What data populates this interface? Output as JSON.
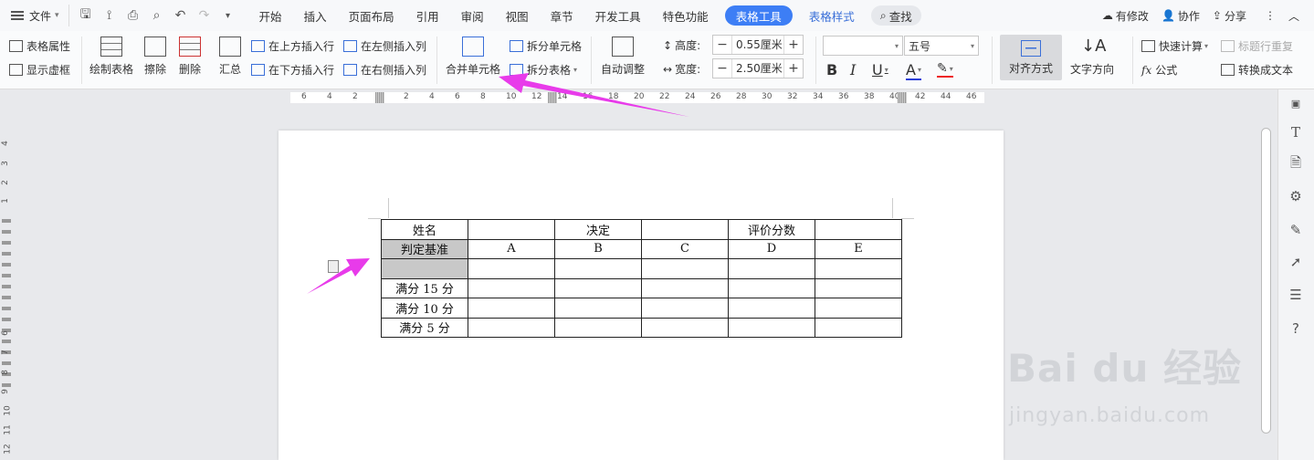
{
  "menubar": {
    "file_label": "文件",
    "tabs": [
      "开始",
      "插入",
      "页面布局",
      "引用",
      "审阅",
      "视图",
      "章节",
      "开发工具",
      "特色功能"
    ],
    "tool_tab": "表格工具",
    "tool_tab2": "表格样式",
    "search": "查找",
    "right": {
      "changes": "有修改",
      "collab": "协作",
      "share": "分享"
    }
  },
  "ribbon": {
    "table_props": "表格属性",
    "show_grid": "显示虚框",
    "draw_table": "绘制表格",
    "erase": "擦除",
    "delete": "删除",
    "summary": "汇总",
    "insert_above": "在上方插入行",
    "insert_below": "在下方插入行",
    "insert_left": "在左侧插入列",
    "insert_right": "在右侧插入列",
    "merge_cells": "合并单元格",
    "split_cells": "拆分单元格",
    "split_table": "拆分表格",
    "auto_fit": "自动调整",
    "height_label": "高度:",
    "height_value": "0.55厘米",
    "width_label": "宽度:",
    "width_value": "2.50厘米",
    "font_name": "",
    "font_size": "五号",
    "align": "对齐方式",
    "text_dir": "文字方向",
    "quick_calc": "快速计算",
    "repeat_header": "标题行重复",
    "formula": "公式",
    "convert_text": "转换成文本"
  },
  "ruler": {
    "numbers": [
      "6",
      "4",
      "2",
      "2",
      "4",
      "6",
      "8",
      "10",
      "12",
      "14",
      "16",
      "18",
      "20",
      "22",
      "24",
      "26",
      "28",
      "30",
      "32",
      "34",
      "36",
      "38",
      "40",
      "42",
      "44",
      "46"
    ],
    "vnumbers": [
      "4",
      "3",
      "2",
      "1",
      "6",
      "7",
      "8",
      "9",
      "10",
      "11",
      "12"
    ]
  },
  "table": {
    "rows": [
      [
        "姓名",
        "",
        "决定",
        "",
        "评价分数",
        ""
      ],
      [
        "判定基准",
        "A",
        "B",
        "C",
        "D",
        "E"
      ],
      [
        "",
        "",
        "",
        "",
        "",
        ""
      ],
      [
        "满分 15 分",
        "",
        "",
        "",
        "",
        ""
      ],
      [
        "满分 10 分",
        "",
        "",
        "",
        "",
        ""
      ],
      [
        "满分 5 分",
        "",
        "",
        "",
        "",
        ""
      ]
    ]
  },
  "watermark": {
    "logo": "Bai du 经验",
    "url": "jingyan.baidu.com"
  },
  "colors": {
    "accent": "#3d7ef5",
    "arrow": "#e83bea"
  }
}
